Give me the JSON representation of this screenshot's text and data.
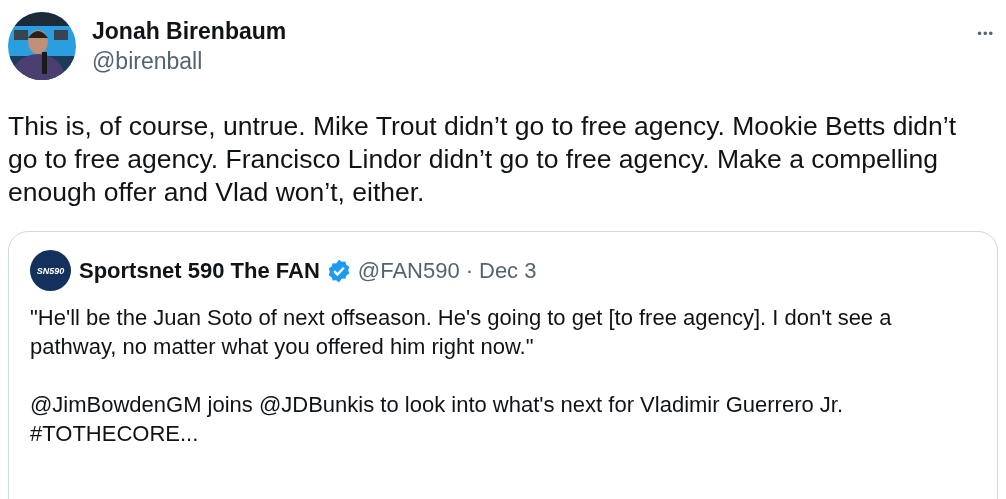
{
  "author": {
    "name": "Jonah Birenbaum",
    "handle": "@birenball"
  },
  "more_menu": "•••",
  "text": "This is, of course, untrue. Mike Trout didn’t go to free agency. Mookie Betts didn’t go to free agency. Francisco Lindor didn’t go to free agency. Make a compelling enough offer and Vlad won’t, either.",
  "quoted": {
    "logo": "SN590",
    "name": "Sportsnet 590 The FAN",
    "verified": true,
    "handle": "@FAN590",
    "separator": "·",
    "date": "Dec 3",
    "paragraphs": [
      "\"He'll be the Juan Soto of next offseason. He's going to get [to free agency]. I don't see a pathway, no matter what you offered him right now.\"",
      "@JimBowdenGM joins @JDBunkis to look into what's next for Vladimir Guerrero Jr. #TOTHECORE..."
    ]
  }
}
